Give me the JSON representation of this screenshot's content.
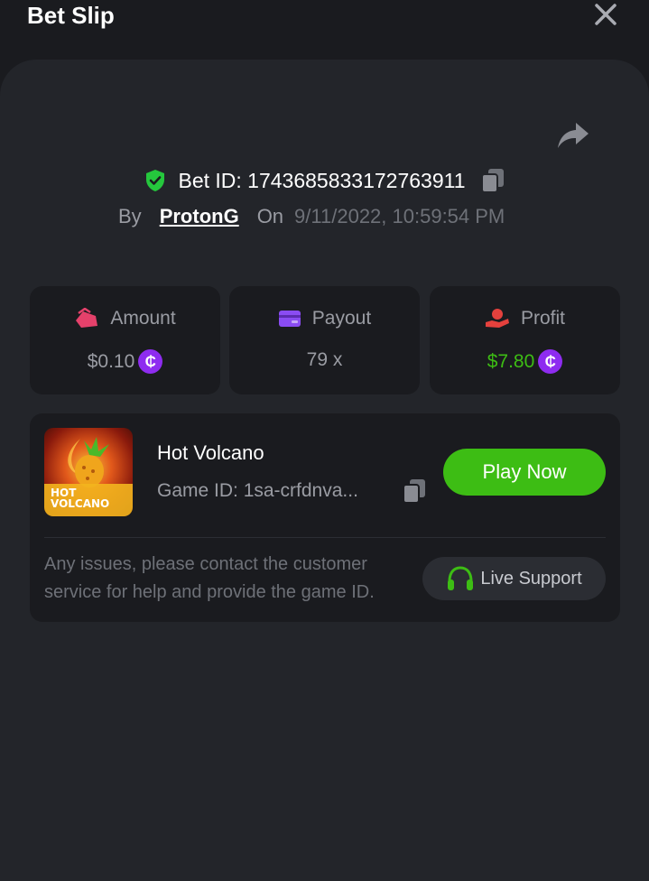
{
  "header": {
    "title": "Bet Slip"
  },
  "bet": {
    "id_text": "Bet ID: 1743685833172763911",
    "by_label": "By",
    "user": "ProtonG",
    "on_label": "On",
    "datetime": "9/11/2022, 10:59:54 PM"
  },
  "stats": [
    {
      "label": "Amount",
      "value": "$0.10",
      "has_coin": true,
      "value_color": "#9a9ca3",
      "icon": "wallet-hand-icon"
    },
    {
      "label": "Payout",
      "value": "79 x",
      "has_coin": false,
      "value_color": "#9a9ca3",
      "icon": "card-icon"
    },
    {
      "label": "Profit",
      "value": "$7.80",
      "has_coin": true,
      "value_color": "#3dbd14",
      "icon": "profit-hand-icon"
    }
  ],
  "coin_symbol": "₵",
  "game": {
    "thumb_text_1": "HOT",
    "thumb_text_2": "VOLCANO",
    "name": "Hot Volcano",
    "id_text": "Game ID: 1sa-crfdnva...",
    "play_label": "Play Now",
    "issues_text": "Any issues, please contact the customer service for help and provide the game ID.",
    "support_label": "Live Support"
  },
  "colors": {
    "background": "#1a1b1f",
    "panel": "#23252a",
    "accent_green": "#3dbd14",
    "coin_purple": "#8e2cf0",
    "amount_pink": "#e5416b",
    "payout_purple": "#8a4cf2",
    "profit_red": "#e5413d"
  }
}
